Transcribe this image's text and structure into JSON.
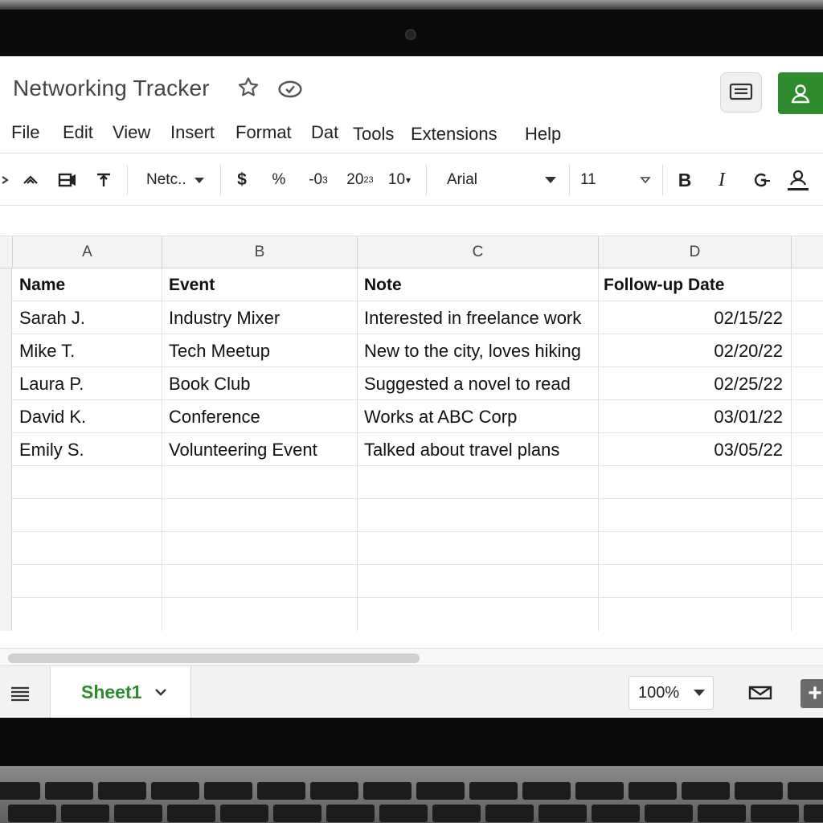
{
  "document": {
    "title": "Networking Tracker"
  },
  "menu": [
    "File",
    "Edit",
    "View",
    "Insert",
    "Format",
    "Dat",
    "Tools",
    "Extensions",
    "Help"
  ],
  "toolbar": {
    "number_format": "Netc..",
    "currency": "$",
    "percent": "%",
    "decimal_decrease": "-0",
    "decimal_decrease_sub": "3",
    "decimal_increase": "20",
    "decimal_increase_sub": "23",
    "more_formats": "10",
    "font": "Arial",
    "font_size": "11",
    "bold": "B",
    "italic": "I"
  },
  "columns": [
    "A",
    "B",
    "C",
    "D"
  ],
  "table": {
    "header": [
      "Name",
      "Event",
      "Note",
      "Follow-up Date"
    ],
    "rows": [
      [
        "Sarah J.",
        "Industry Mixer",
        "Interested in freelance work",
        "02/15/22"
      ],
      [
        "Mike T.",
        "Tech Meetup",
        "New to the city, loves hiking",
        "02/20/22"
      ],
      [
        "Laura P.",
        "Book Club",
        "Suggested a novel to read",
        "02/25/22"
      ],
      [
        "David K.",
        "Conference",
        "Works at ABC Corp",
        "03/01/22"
      ],
      [
        "Emily S.",
        "Volunteering Event",
        "Talked about travel plans",
        "03/05/22"
      ]
    ]
  },
  "sheets": {
    "active": "Sheet1"
  },
  "zoom": "100%",
  "colors": {
    "accent_green": "#2e8b2e"
  }
}
